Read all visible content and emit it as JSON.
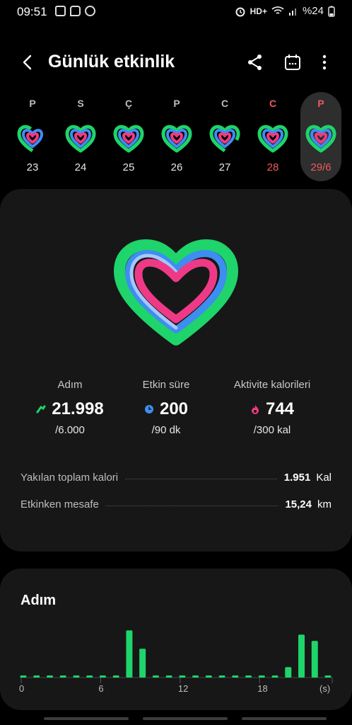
{
  "status_bar": {
    "time": "09:51",
    "network": "HD+",
    "battery": "%24",
    "icons": [
      "gallery-icon",
      "message-icon",
      "screen-record-icon",
      "alarm-icon",
      "wifi-icon",
      "signal-icon",
      "battery-icon"
    ]
  },
  "header": {
    "title": "Günlük etkinlik",
    "back_icon": "back-arrow-icon",
    "share_icon": "share-icon",
    "calendar_icon": "calendar-icon",
    "more_icon": "more-vert-icon"
  },
  "week": [
    {
      "letter": "P",
      "date": "23",
      "weekend": false,
      "selected": false
    },
    {
      "letter": "S",
      "date": "24",
      "weekend": false,
      "selected": false
    },
    {
      "letter": "Ç",
      "date": "25",
      "weekend": false,
      "selected": false
    },
    {
      "letter": "P",
      "date": "26",
      "weekend": false,
      "selected": false
    },
    {
      "letter": "C",
      "date": "27",
      "weekend": false,
      "selected": false
    },
    {
      "letter": "C",
      "date": "28",
      "weekend": true,
      "selected": false
    },
    {
      "letter": "P",
      "date": "29/6",
      "weekend": true,
      "selected": true
    }
  ],
  "summary": {
    "steps": {
      "label": "Adım",
      "value": "21.998",
      "goal": "/6.000",
      "icon": "walking-icon"
    },
    "active_time": {
      "label": "Etkin süre",
      "value": "200",
      "goal": "/90 dk",
      "icon": "clock-icon"
    },
    "calories": {
      "label": "Aktivite kalorileri",
      "value": "744",
      "goal": "/300 kal",
      "icon": "flame-icon"
    }
  },
  "details": {
    "total_calories": {
      "label": "Yakılan toplam kalori",
      "value": "1.951",
      "unit": "Kal"
    },
    "active_distance": {
      "label": "Etkinken mesafe",
      "value": "15,24",
      "unit": "km"
    }
  },
  "colors": {
    "steps_ring": "#1ed46b",
    "time_ring": "#3e8df0",
    "calorie_ring": "#ee3a86",
    "weekend_text": "#ef5a5a",
    "card_bg": "#171717"
  },
  "chart_data": {
    "type": "bar",
    "title": "Adım",
    "x": [
      0,
      1,
      2,
      3,
      4,
      5,
      6,
      7,
      8,
      9,
      10,
      11,
      12,
      13,
      14,
      15,
      16,
      17,
      18,
      19,
      20,
      21,
      22,
      23
    ],
    "values": [
      0.02,
      0,
      0,
      0.02,
      0,
      0,
      0,
      0.02,
      0.9,
      0.55,
      0.02,
      0.02,
      0.02,
      0.02,
      0.02,
      0,
      0.02,
      0.02,
      0,
      0.02,
      0.2,
      0.82,
      0.7,
      0.02
    ],
    "xticks": [
      "0",
      "6",
      "12",
      "18"
    ],
    "xunit": "(s)",
    "color": "#1ed46b"
  }
}
